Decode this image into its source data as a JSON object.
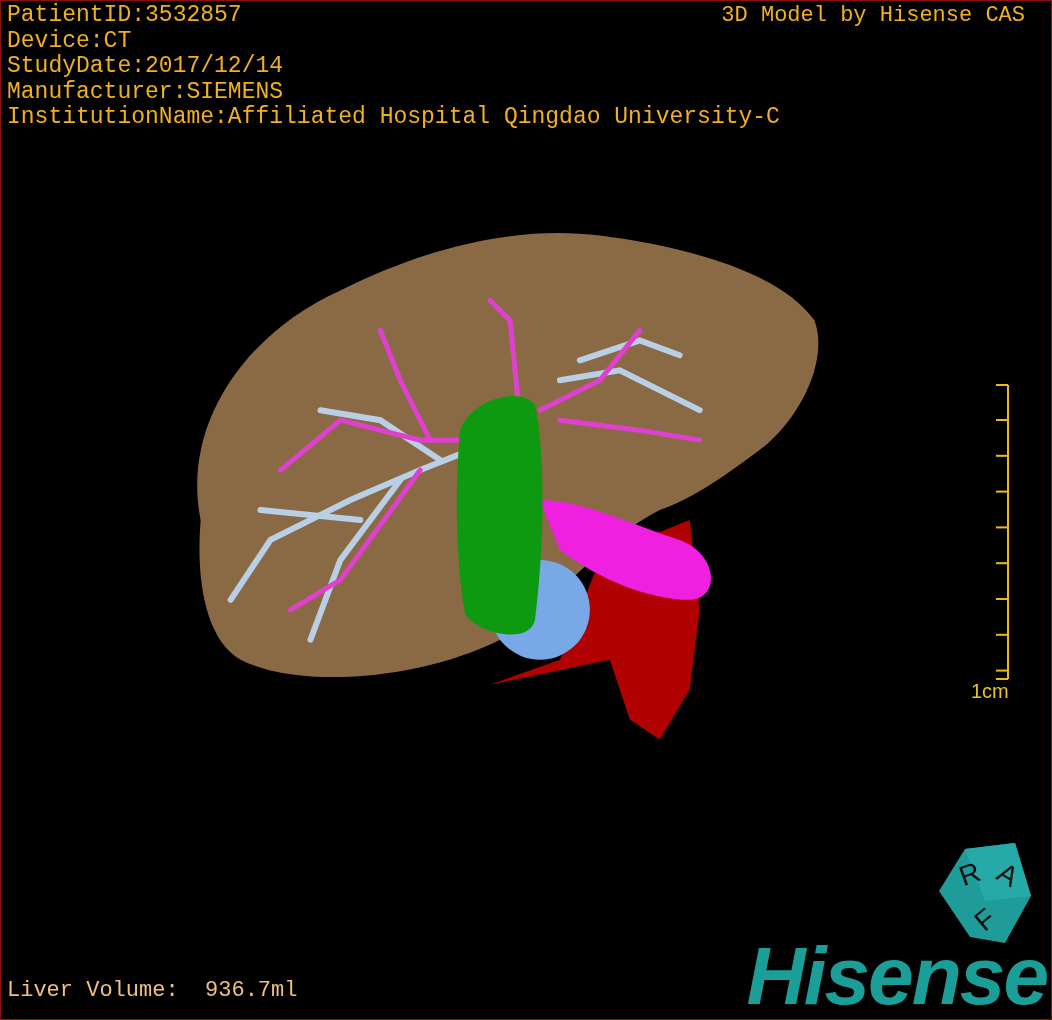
{
  "info_lines": [
    "PatientID:3532857",
    "Device:CT",
    "StudyDate:2017/12/14",
    "Manufacturer:SIEMENS",
    "InstitutionName:Affiliated Hospital Qingdao University-C"
  ],
  "title": "3D Model by Hisense CAS",
  "scale_bar": {
    "label": "1cm"
  },
  "orientation_cube": {
    "letters": [
      "R",
      "A",
      "F"
    ]
  },
  "logo": "Hisense",
  "liver_volume": "Liver Volume:  936.7ml"
}
